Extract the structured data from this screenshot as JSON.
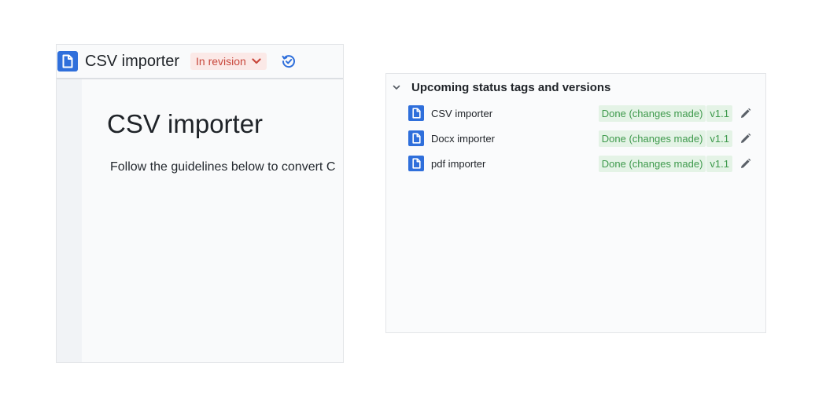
{
  "document": {
    "header_title": "CSV importer",
    "status": "In revision",
    "title": "CSV importer",
    "paragraph": "Follow the guidelines below to convert C"
  },
  "panel": {
    "title": "Upcoming status tags and versions",
    "items": [
      {
        "name": "CSV importer",
        "status": "Done (changes made)",
        "version": "v1.1"
      },
      {
        "name": "Docx importer",
        "status": "Done (changes made)",
        "version": "v1.1"
      },
      {
        "name": "pdf importer",
        "status": "Done (changes made)",
        "version": "v1.1"
      }
    ]
  },
  "colors": {
    "doc_icon": "#2f6fdb",
    "status_revision_text": "#c8473b",
    "status_revision_bg": "#fbe9e7",
    "tag_done_text": "#3f9a4d",
    "tag_done_bg": "#e4f3e6",
    "history_icon": "#2f6fdb"
  },
  "icons": {
    "document": "document-icon",
    "dropdown": "chevron-down-icon",
    "history": "history-check-icon",
    "collapse": "chevron-down-icon",
    "edit": "pencil-icon"
  }
}
